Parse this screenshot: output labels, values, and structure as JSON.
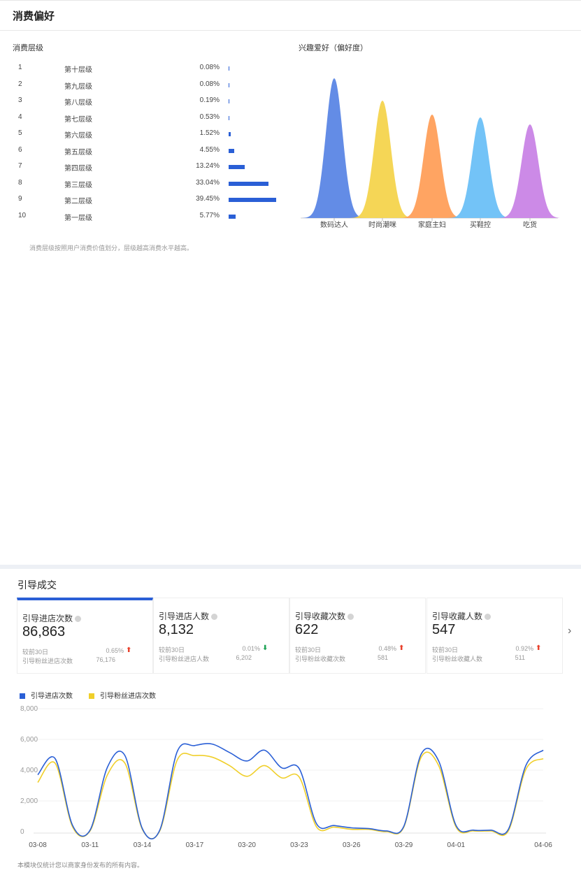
{
  "consumption": {
    "title": "消费偏好",
    "level_title": "消费层级",
    "interest_title": "兴趣爱好（偏好度）",
    "levels": [
      {
        "rank": "1",
        "name": "第十层级",
        "pct": "0.08%",
        "value": 0.08
      },
      {
        "rank": "2",
        "name": "第九层级",
        "pct": "0.08%",
        "value": 0.08
      },
      {
        "rank": "3",
        "name": "第八层级",
        "pct": "0.19%",
        "value": 0.19
      },
      {
        "rank": "4",
        "name": "第七层级",
        "pct": "0.53%",
        "value": 0.53
      },
      {
        "rank": "5",
        "name": "第六层级",
        "pct": "1.52%",
        "value": 1.52
      },
      {
        "rank": "6",
        "name": "第五层级",
        "pct": "4.55%",
        "value": 4.55
      },
      {
        "rank": "7",
        "name": "第四层级",
        "pct": "13.24%",
        "value": 13.24
      },
      {
        "rank": "8",
        "name": "第三层级",
        "pct": "33.04%",
        "value": 33.04
      },
      {
        "rank": "9",
        "name": "第二层级",
        "pct": "39.45%",
        "value": 39.45
      },
      {
        "rank": "10",
        "name": "第一层级",
        "pct": "5.77%",
        "value": 5.77
      }
    ],
    "note": "消费层级按照用户消费价值划分，层级越高消费水平越高。"
  },
  "interests": {
    "categories": [
      "数码达人",
      "时尚潮咪",
      "家庭主妇",
      "买鞋控",
      "吃货"
    ],
    "relative_heights": [
      1.0,
      0.84,
      0.74,
      0.72,
      0.67
    ],
    "colors": [
      "#5b86e5",
      "#f4d44d",
      "#ff9f5a",
      "#6cc0f7",
      "#c984e6"
    ]
  },
  "guide": {
    "title": "引导成交",
    "cards": [
      {
        "label": "引导进店次数",
        "value": "86,863",
        "cmp_label": "较前30日",
        "cmp_value": "0.65%",
        "trend": "up",
        "sub_label": "引导粉丝进店次数",
        "sub_value": "76,176",
        "active": true
      },
      {
        "label": "引导进店人数",
        "value": "8,132",
        "cmp_label": "较前30日",
        "cmp_value": "0.01%",
        "trend": "down",
        "sub_label": "引导粉丝进店人数",
        "sub_value": "6,202",
        "active": false
      },
      {
        "label": "引导收藏次数",
        "value": "622",
        "cmp_label": "较前30日",
        "cmp_value": "0.48%",
        "trend": "up",
        "sub_label": "引导粉丝收藏次数",
        "sub_value": "581",
        "active": false
      },
      {
        "label": "引导收藏人数",
        "value": "547",
        "cmp_label": "较前30日",
        "cmp_value": "0.92%",
        "trend": "up",
        "sub_label": "引导粉丝收藏人数",
        "sub_value": "511",
        "active": false
      }
    ],
    "next_icon": "chevron-right-icon",
    "footnote": "本模块仅统计您以商家身份发布的所有内容。"
  },
  "chart_data": {
    "type": "line",
    "ylim": [
      0,
      8000
    ],
    "yticks": [
      "8,000",
      "6,000",
      "4,000",
      "2,000",
      "0"
    ],
    "ytick_values": [
      8000,
      6000,
      4000,
      2000,
      0
    ],
    "xticks": [
      "03-08",
      "03-11",
      "03-14",
      "03-17",
      "03-20",
      "03-23",
      "03-26",
      "03-29",
      "04-01",
      "04-06"
    ],
    "x": [
      "03-08",
      "03-09",
      "03-10",
      "03-11",
      "03-12",
      "03-13",
      "03-14",
      "03-15",
      "03-16",
      "03-17",
      "03-18",
      "03-19",
      "03-20",
      "03-21",
      "03-22",
      "03-23",
      "03-24",
      "03-25",
      "03-26",
      "03-27",
      "03-28",
      "03-29",
      "03-30",
      "03-31",
      "04-01",
      "04-02",
      "04-03",
      "04-04",
      "04-05",
      "04-06"
    ],
    "series": [
      {
        "name": "引导进店次数",
        "color": "#2a5fd6",
        "values": [
          3700,
          4750,
          400,
          100,
          4200,
          4950,
          200,
          100,
          5200,
          5600,
          5700,
          5150,
          4600,
          5300,
          4150,
          4100,
          500,
          400,
          250,
          200,
          50,
          350,
          5050,
          4600,
          400,
          100,
          100,
          150,
          4300,
          5300
        ]
      },
      {
        "name": "引导粉丝进店次数",
        "color": "#f0cf2a",
        "values": [
          3200,
          4450,
          300,
          50,
          3700,
          4450,
          150,
          50,
          4650,
          4950,
          4850,
          4300,
          3600,
          4300,
          3500,
          3550,
          300,
          300,
          150,
          150,
          0,
          300,
          4850,
          4300,
          300,
          50,
          50,
          50,
          4050,
          4750
        ]
      }
    ]
  }
}
